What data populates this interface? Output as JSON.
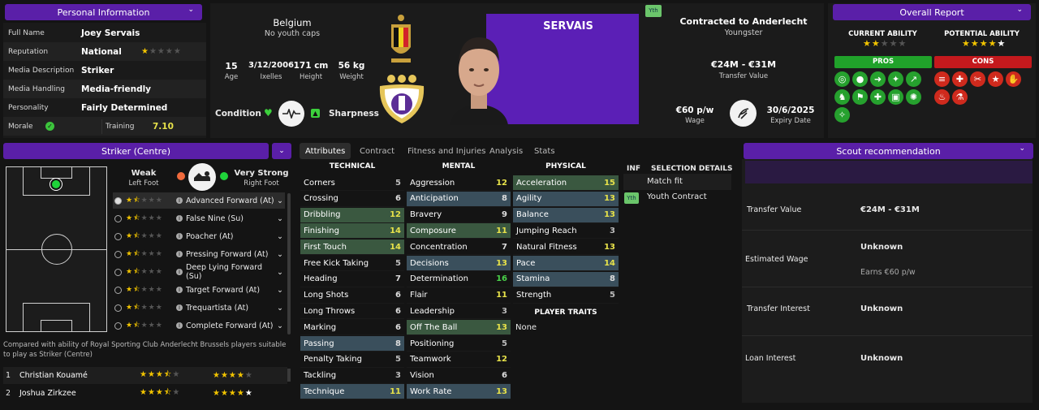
{
  "personal": {
    "title": "Personal Information",
    "rows": [
      {
        "label": "Full Name",
        "value": "Joey Servais"
      },
      {
        "label": "Reputation",
        "value": "National",
        "stars_on": 1,
        "stars_total": 5
      },
      {
        "label": "Media Description",
        "value": "Striker"
      },
      {
        "label": "Media Handling",
        "value": "Media-friendly"
      },
      {
        "label": "Personality",
        "value": "Fairly Determined"
      }
    ],
    "morale_label": "Morale",
    "training_label": "Training",
    "training_value": "7.10"
  },
  "player": {
    "nation": "Belgium",
    "caps": "No youth caps",
    "age": "15",
    "age_label": "Age",
    "dob": "3/12/2006",
    "birthplace": "Ixelles",
    "height": "171 cm",
    "height_label": "Height",
    "weight": "56 kg",
    "weight_label": "Weight",
    "condition_label": "Condition",
    "sharpness_label": "Sharpness",
    "surname": "SERVAIS",
    "yth_badge": "Yth"
  },
  "contract": {
    "title": "Contracted to Anderlecht",
    "subtitle": "Youngster",
    "value": "€24M - €31M",
    "value_label": "Transfer Value",
    "wage": "€60 p/w",
    "wage_label": "Wage",
    "expiry": "30/6/2025",
    "expiry_label": "Expiry Date"
  },
  "overall": {
    "title": "Overall Report",
    "current_label": "CURRENT ABILITY",
    "potential_label": "POTENTIAL ABILITY",
    "current_stars": 2,
    "potential_stars": 4.5,
    "pros_label": "PROS",
    "cons_label": "CONS"
  },
  "position": {
    "title": "Striker (Centre)",
    "weak_label": "Weak",
    "weak_sub": "Left Foot",
    "strong_label": "Very Strong",
    "strong_sub": "Right Foot",
    "roles": [
      "Advanced Forward (At)",
      "False Nine (Su)",
      "Poacher (At)",
      "Pressing Forward (At)",
      "Deep Lying Forward (Su)",
      "Target Forward (At)",
      "Trequartista (At)",
      "Complete Forward (At)"
    ],
    "compare_text": "Compared with ability of Royal Sporting Club Anderlecht Brussels players suitable to play as Striker (Centre)",
    "compare": [
      {
        "rank": "1",
        "name": "Christian Kouamé",
        "ca": 3.5,
        "pa": 4
      },
      {
        "rank": "2",
        "name": "Joshua Zirkzee",
        "ca": 3.5,
        "pa": 5
      }
    ]
  },
  "tabs": [
    "Attributes",
    "Contract",
    "Fitness and Injuries",
    "Analysis",
    "Stats"
  ],
  "technical": {
    "title": "TECHNICAL",
    "items": [
      [
        "Corners",
        "5"
      ],
      [
        "Crossing",
        "6"
      ],
      [
        "Dribbling",
        "12"
      ],
      [
        "Finishing",
        "14"
      ],
      [
        "First Touch",
        "14"
      ],
      [
        "Free Kick Taking",
        "5"
      ],
      [
        "Heading",
        "7"
      ],
      [
        "Long Shots",
        "6"
      ],
      [
        "Long Throws",
        "6"
      ],
      [
        "Marking",
        "6"
      ],
      [
        "Passing",
        "8"
      ],
      [
        "Penalty Taking",
        "5"
      ],
      [
        "Tackling",
        "3"
      ],
      [
        "Technique",
        "11"
      ]
    ]
  },
  "mental": {
    "title": "MENTAL",
    "items": [
      [
        "Aggression",
        "12"
      ],
      [
        "Anticipation",
        "8"
      ],
      [
        "Bravery",
        "9"
      ],
      [
        "Composure",
        "11"
      ],
      [
        "Concentration",
        "7"
      ],
      [
        "Decisions",
        "13"
      ],
      [
        "Determination",
        "16"
      ],
      [
        "Flair",
        "11"
      ],
      [
        "Leadership",
        "3"
      ],
      [
        "Off The Ball",
        "13"
      ],
      [
        "Positioning",
        "5"
      ],
      [
        "Teamwork",
        "12"
      ],
      [
        "Vision",
        "6"
      ],
      [
        "Work Rate",
        "13"
      ]
    ]
  },
  "physical": {
    "title": "PHYSICAL",
    "items": [
      [
        "Acceleration",
        "15"
      ],
      [
        "Agility",
        "13"
      ],
      [
        "Balance",
        "13"
      ],
      [
        "Jumping Reach",
        "3"
      ],
      [
        "Natural Fitness",
        "13"
      ],
      [
        "Pace",
        "14"
      ],
      [
        "Stamina",
        "8"
      ],
      [
        "Strength",
        "5"
      ]
    ]
  },
  "traits": {
    "title": "PLAYER TRAITS",
    "value": "None"
  },
  "selection": {
    "inf": "INF",
    "title": "SELECTION DETAILS",
    "match_fit": "Match fit",
    "yth": "Yth",
    "youth_contract": "Youth Contract"
  },
  "scout": {
    "title": "Scout recommendation",
    "rows": [
      {
        "label": "Transfer Value",
        "value": "€24M - €31M"
      },
      {
        "label": "Estimated Wage",
        "value": "Unknown",
        "sub": "Earns €60 p/w"
      },
      {
        "label": "Transfer Interest",
        "value": "Unknown"
      },
      {
        "label": "Loan Interest",
        "value": "Unknown"
      }
    ]
  },
  "colors": {
    "accent": "#5a1fa8",
    "pros": "#20a22a",
    "cons": "#c4191d",
    "highlight": "#e7e24a",
    "good": "#4ad14a"
  }
}
